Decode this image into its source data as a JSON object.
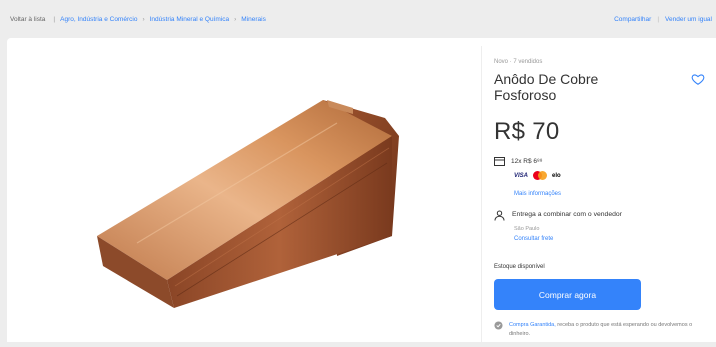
{
  "topbar": {
    "back_label": "Voltar à lista",
    "breadcrumbs": [
      "Agro, Indústria e Comércio",
      "Indústria Mineral e Química",
      "Minerais"
    ],
    "actions": [
      "Compartilhar",
      "Vender um igual"
    ]
  },
  "product": {
    "condition": "Novo · 7 vendidos",
    "title": "Anôdo De Cobre Fosforoso",
    "price": "R$ 70",
    "installments": "12x R$ 6⁸⁸",
    "card_brands": [
      "VISA",
      "mastercard",
      "elo"
    ],
    "more_info": "Mais informações",
    "delivery": "Entrega a combinar com o vendedor",
    "delivery_location": "São Paulo",
    "delivery_link": "Consultar frete",
    "stock": "Estoque disponível",
    "buy_button": "Comprar agora",
    "guarantee_link": "Compra Garantida,",
    "guarantee_text": " receba o produto que está esperando ou devolvemos o dinheiro."
  },
  "colors": {
    "accent": "#3483fa",
    "background": "#ededed",
    "copper_light": "#e8a877",
    "copper_dark": "#7a3a1e"
  }
}
